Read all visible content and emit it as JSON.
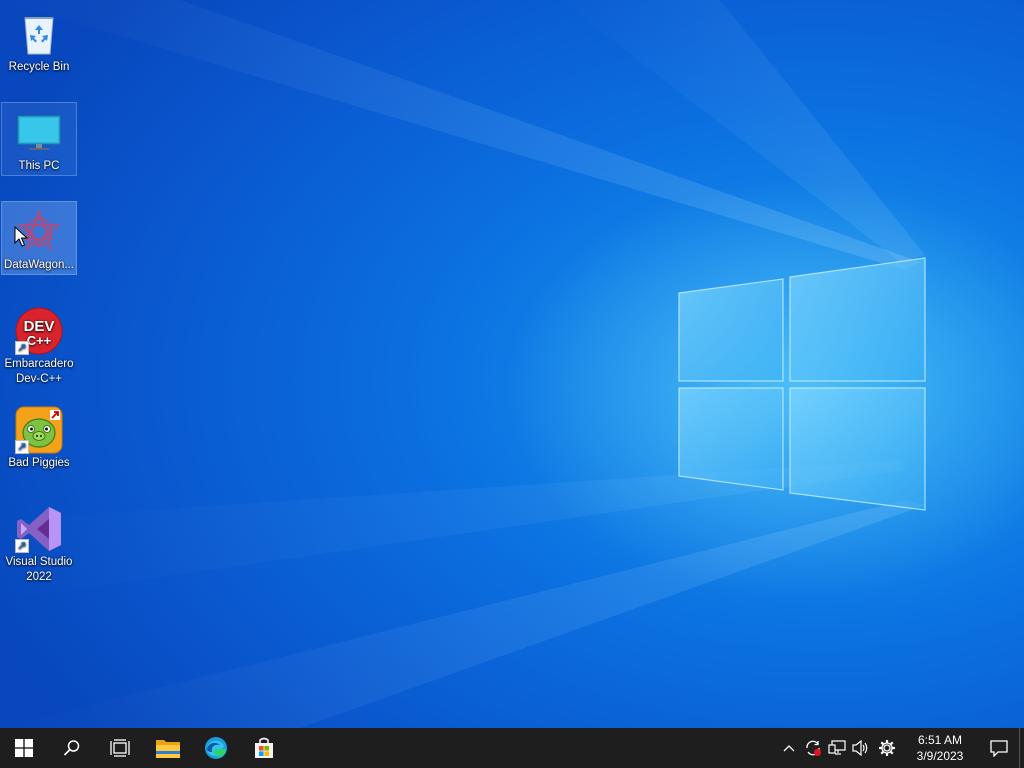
{
  "desktop": {
    "icons": [
      {
        "label": "Recycle Bin",
        "icon": "recycle-bin-icon"
      },
      {
        "label": "This PC",
        "icon": "this-pc-icon"
      },
      {
        "label": "DataWagon...",
        "icon": "datawagon-icon"
      },
      {
        "label": "Embarcadero Dev-C++",
        "icon": "devcpp-icon",
        "logo_text": "DEV C++"
      },
      {
        "label": "Bad Piggies",
        "icon": "bad-piggies-icon"
      },
      {
        "label": "Visual Studio 2022",
        "icon": "visual-studio-icon"
      }
    ]
  },
  "taskbar": {
    "start": "windows-start-icon",
    "search": "search-icon",
    "task_view": "task-view-icon",
    "pinned": [
      "file-explorer-icon",
      "edge-icon",
      "microsoft-store-icon"
    ],
    "tray": {
      "icons": [
        "chevron-up-icon",
        "sync-icon",
        "network-icon",
        "volume-icon",
        "settings-gear-icon"
      ],
      "time": "6:51 AM",
      "date": "3/9/2023"
    },
    "notification": "action-center-icon"
  },
  "colors": {
    "taskbar": "#1e1e1e",
    "wallpaper_primary": "#0b6fe0",
    "wallpaper_glow": "#78dcff"
  }
}
